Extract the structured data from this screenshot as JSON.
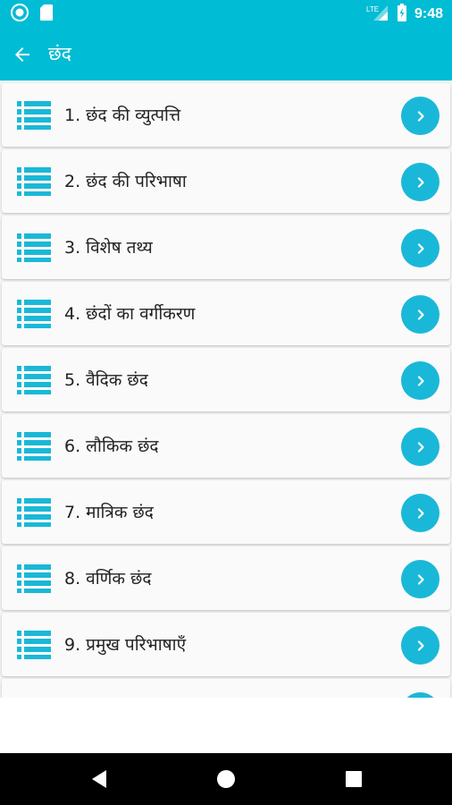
{
  "status_bar": {
    "time": "9:48",
    "network": "LTE",
    "icons": [
      "circle-notification-icon",
      "sd-card-icon",
      "signal-icon",
      "battery-icon"
    ]
  },
  "app_bar": {
    "title": "छंद",
    "back_icon": "arrow-back-icon"
  },
  "items": [
    {
      "label": "1. छंद की व्युत्पत्ति"
    },
    {
      "label": "2. छंद की परिभाषा"
    },
    {
      "label": "3. विशेष तथ्य"
    },
    {
      "label": "4. छंदों का वर्गीकरण"
    },
    {
      "label": "5. वैदिक छंद"
    },
    {
      "label": "6. लौकिक छंद"
    },
    {
      "label": "7. मात्रिक छंद"
    },
    {
      "label": "8. वर्णिक छंद"
    },
    {
      "label": "9. प्रमुख परिभाषाएँ"
    }
  ],
  "nav_bar": {
    "icons": [
      "back-triangle-icon",
      "home-circle-icon",
      "recents-square-icon"
    ]
  },
  "colors": {
    "accent": "#00bcd4",
    "icon_blue": "#1ab8d8",
    "background": "#f3f3f3"
  }
}
